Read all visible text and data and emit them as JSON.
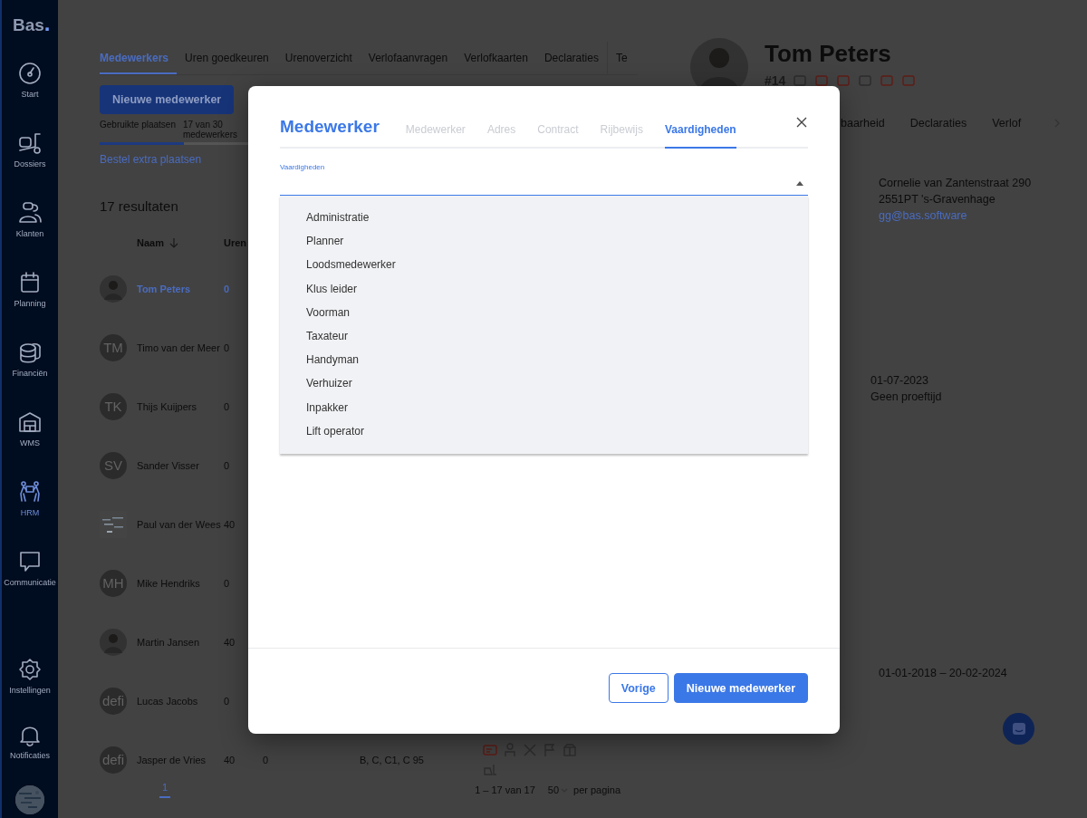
{
  "sidebar": {
    "logo": "Bas",
    "logo_dot": ".",
    "items": [
      {
        "label": "Start",
        "selected": false
      },
      {
        "label": "Dossiers",
        "selected": false
      },
      {
        "label": "Klanten",
        "selected": false
      },
      {
        "label": "Planning",
        "selected": false
      },
      {
        "label": "Financiën",
        "selected": false
      },
      {
        "label": "WMS",
        "selected": false
      },
      {
        "label": "HRM",
        "selected": true
      },
      {
        "label": "Communicatie",
        "selected": false
      }
    ],
    "bottom_items": [
      {
        "label": "Instellingen"
      },
      {
        "label": "Notificaties"
      }
    ]
  },
  "tabs": [
    {
      "label": "Medewerkers",
      "selected": true
    },
    {
      "label": "Uren goedkeuren",
      "selected": false
    },
    {
      "label": "Urenoverzicht",
      "selected": false
    },
    {
      "label": "Verlofaanvragen",
      "selected": false
    },
    {
      "label": "Verlofkaarten",
      "selected": false
    },
    {
      "label": "Declaraties",
      "selected": false
    },
    {
      "label": "Te",
      "selected": false
    }
  ],
  "new_button": "Nieuwe medewerker",
  "seats": {
    "label": "Gebruikte plaatsen",
    "count": "17 van 30 medewerkers",
    "level": 0.57,
    "link": "Bestel extra plaatsen"
  },
  "results": "17 resultaten",
  "table": {
    "columns": [
      {
        "label": "Naam",
        "sorted": true
      },
      {
        "label": "Uren"
      }
    ],
    "rows": [
      {
        "name": "Tom Peters",
        "hours": "0",
        "selected": true
      },
      {
        "name": "Timo van der Meer",
        "hours": "0",
        "avatar": {
          "kind": "initials",
          "text": "TM"
        },
        "selected": false
      },
      {
        "name": "Thijs Kuijpers",
        "hours": "0",
        "avatar": {
          "kind": "initials",
          "text": "TK"
        },
        "selected": false
      },
      {
        "name": "Sander Visser",
        "hours": "0",
        "avatar": {
          "kind": "initials",
          "text": "SV"
        },
        "selected": false
      },
      {
        "name": "Paul van der Wees",
        "hours": "40",
        "selected": false
      },
      {
        "name": "Mike Hendriks",
        "hours": "0",
        "avatar": {
          "kind": "initials",
          "text": "MH"
        },
        "selected": false
      },
      {
        "name": "Martin Jansen",
        "hours": "40",
        "selected": false
      },
      {
        "name": "Lucas Jacobs",
        "hours": "0",
        "avatar": {
          "kind": "initials",
          "text": "defi"
        },
        "selected": false
      },
      {
        "name": "Jasper de Vries",
        "hours": "40",
        "avatar": {
          "kind": "initials",
          "text": "defi"
        },
        "selected": false,
        "column_3": "0",
        "column_4": "B, C, C1, C 95",
        "icons": true
      }
    ]
  },
  "pagination": {
    "pages": [
      {
        "label": "1",
        "selected": true
      }
    ],
    "range": "1 – 17 van 17",
    "per_page": "50",
    "per_page_label": "per pagina"
  },
  "detail": {
    "name": "Tom Peters",
    "number": "#14",
    "tabs": [
      {
        "label": "baarheid"
      },
      {
        "label": "Declaraties"
      },
      {
        "label": "Verlof"
      }
    ],
    "address": [
      "Cornelie van Zantenstraat 290",
      "2551PT 's-Gravenhage"
    ],
    "email": "gg@bas.software",
    "contract": [
      "01-07-2023",
      "Geen proeftijd"
    ],
    "period": "01-01-2018 – 20-02-2024"
  },
  "modal": {
    "title": "Medewerker",
    "steps": [
      {
        "label": "Medewerker",
        "selected": false
      },
      {
        "label": "Adres",
        "selected": false
      },
      {
        "label": "Contract",
        "selected": false
      },
      {
        "label": "Rijbewijs",
        "selected": false
      },
      {
        "label": "Vaardigheden",
        "selected": true
      }
    ],
    "field": {
      "label": "Vaardigheden",
      "expanded": true
    },
    "options": [
      "Administratie",
      "Planner",
      "Loodsmedewerker",
      "Klus leider",
      "Voorman",
      "Taxateur",
      "Handyman",
      "Verhuizer",
      "Inpakker",
      "Lift operator"
    ],
    "buttons": [
      {
        "label": "Vorige",
        "kind": "secondary"
      },
      {
        "label": "Nieuwe medewerker",
        "kind": "primary"
      }
    ]
  }
}
